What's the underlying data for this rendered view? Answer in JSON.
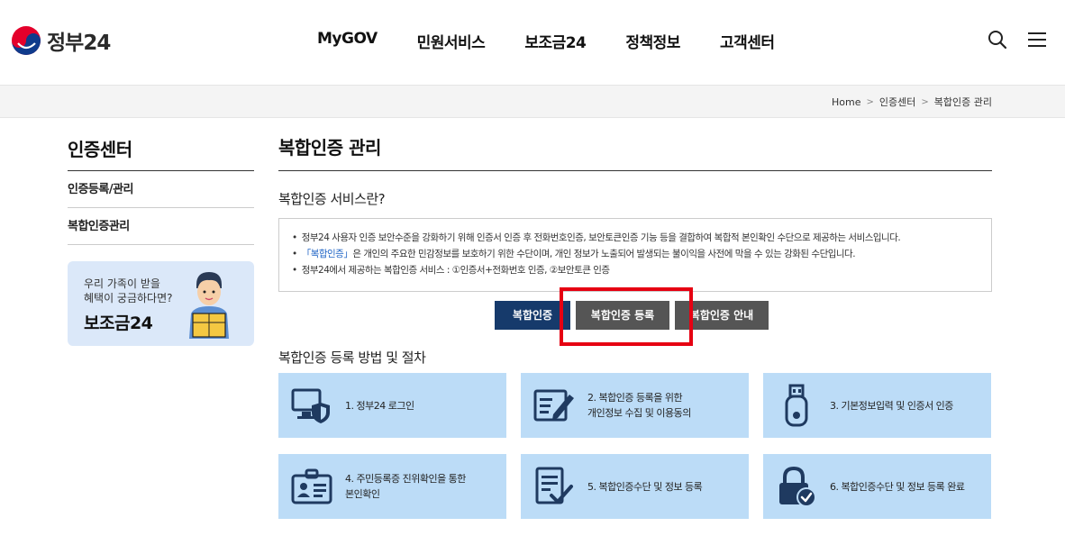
{
  "header": {
    "logo_text": "정부24",
    "nav": [
      "MyGOV",
      "민원서비스",
      "보조금24",
      "정책정보",
      "고객센터"
    ]
  },
  "breadcrumb": [
    "Home",
    "인증센터",
    "복합인증 관리"
  ],
  "sidebar": {
    "title": "인증센터",
    "items": [
      "인증등록/관리",
      "복합인증관리"
    ],
    "banner": {
      "line1": "우리 가족이 받을",
      "line2": "혜택이 궁금하다면?",
      "title": "보조금24"
    }
  },
  "main": {
    "title": "복합인증 관리",
    "intro_title": "복합인증 서비스란?",
    "info": {
      "line1": "정부24 사용자 인증 보안수준을 강화하기 위해 인증서 인증 후 전화번호인증, 보안토큰인증 기능 등을 결합하여 복합적 본인확인 수단으로 제공하는 서비스입니다.",
      "line2_highlight": "「복합인증」",
      "line2_rest": "은 개인의 주요한 민감정보를 보호하기 위한 수단이며, 개인 정보가 노출되어 발생되는 불이익을 사전에 막을 수 있는 강화된 수단입니다.",
      "line3": "정부24에서 제공하는 복합인증 서비스 : ①인증서+전화번호 인증, ②보안토큰 인증"
    },
    "tabs": [
      "복합인증",
      "복합인증 등록",
      "복합인증 안내"
    ],
    "steps_title": "복합인증 등록 방법 및 절차",
    "steps": [
      {
        "line1": "1. 정부24 로그인",
        "line2": ""
      },
      {
        "line1": "2. 복합인증 등록을 위한",
        "line2": "개인정보 수집 및 이용동의"
      },
      {
        "line1": "3. 기본정보입력 및 인증서 인증",
        "line2": ""
      },
      {
        "line1": "4. 주민등록증 진위확인을 통한",
        "line2": "본인확인"
      },
      {
        "line1": "5. 복합인증수단 및 정보 등록",
        "line2": ""
      },
      {
        "line1": "6. 복합인증수단 및 정보 등록 완료",
        "line2": ""
      }
    ]
  },
  "colors": {
    "accent_navy": "#163a6b",
    "tab_gray": "#555555",
    "step_bg": "#bcdcf7",
    "highlight_red": "#e60012",
    "link_blue": "#1e63c5"
  }
}
